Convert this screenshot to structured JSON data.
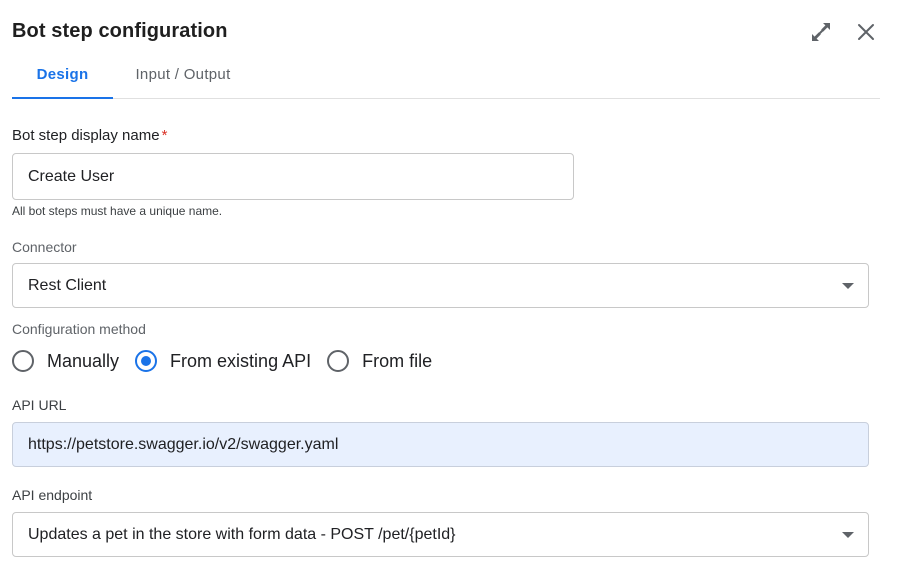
{
  "dialog": {
    "title": "Bot step configuration"
  },
  "tabs": [
    {
      "label": "Design",
      "active": true
    },
    {
      "label": "Input / Output",
      "active": false
    }
  ],
  "form": {
    "display_name": {
      "label": "Bot step display name",
      "required_mark": "*",
      "value": "Create User",
      "helper": "All bot steps must have a unique name."
    },
    "connector": {
      "label": "Connector",
      "value": "Rest Client"
    },
    "config_method": {
      "label": "Configuration method",
      "options": [
        {
          "label": "Manually",
          "selected": false
        },
        {
          "label": "From existing API",
          "selected": true
        },
        {
          "label": "From file",
          "selected": false
        }
      ]
    },
    "api_url": {
      "label": "API URL",
      "value": "https://petstore.swagger.io/v2/swagger.yaml"
    },
    "api_endpoint": {
      "label": "API endpoint",
      "value": "Updates a pet in the store with form data - POST /pet/{petId}"
    }
  },
  "icons": {
    "expand": "expand-diagonal-icon",
    "close": "close-x-icon"
  },
  "colors": {
    "accent": "#1a73e8",
    "required": "#d93025",
    "filled_bg": "#e8f0fe"
  }
}
